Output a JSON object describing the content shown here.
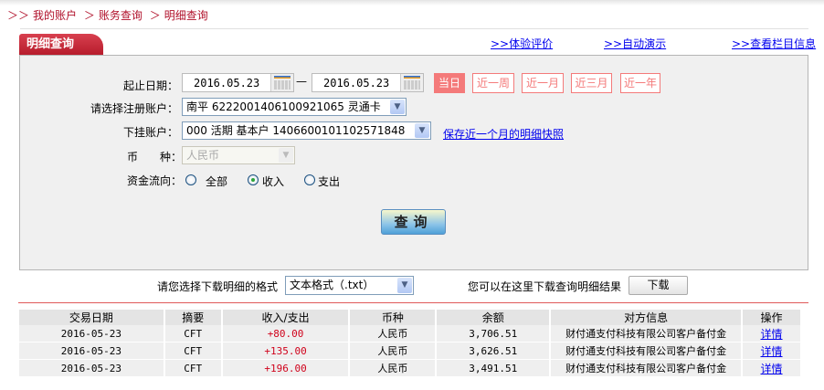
{
  "breadcrumb": {
    "items": [
      "我的账户",
      "账务查询",
      "明细查询"
    ]
  },
  "tab": {
    "title": "明细查询"
  },
  "top_links": [
    ">>体验评价",
    ">>自动演示",
    ">>查看栏目信息"
  ],
  "form": {
    "date_label": "起止日期：",
    "start_date": "2016.05.23",
    "dash": "—",
    "end_date": "2016.05.23",
    "quick_ranges": [
      {
        "label": "当日",
        "active": true
      },
      {
        "label": "近一周",
        "active": false
      },
      {
        "label": "近一月",
        "active": false
      },
      {
        "label": "近三月",
        "active": false
      },
      {
        "label": "近一年",
        "active": false
      }
    ],
    "reg_account_label": "请选择注册账户：",
    "reg_account_value": "南平  6222001406100921065 灵通卡",
    "sub_account_label": "下挂账户：",
    "sub_account_value": "000 活期 基本户 1406600101102571848",
    "snapshot_link": "保存近一个月的明细快照",
    "currency_label": "币　　种：",
    "currency_value": "人民币",
    "flow_label": "资金流向：",
    "flow_options": [
      {
        "label": "全部",
        "checked": false
      },
      {
        "label": "收入",
        "checked": true
      },
      {
        "label": "支出",
        "checked": false
      }
    ],
    "search_button": "查询"
  },
  "download": {
    "format_label": "请您选择下载明细的格式",
    "format_value": "文本格式（.txt）",
    "hint": "您可以在这里下载查询明细结果",
    "button": "下载"
  },
  "table": {
    "headers": [
      "交易日期",
      "摘要",
      "收入/支出",
      "币种",
      "余额",
      "对方信息",
      "操作"
    ],
    "rows": [
      [
        "2016-05-23",
        "CFT",
        "+80.00",
        "人民币",
        "3,706.51",
        "财付通支付科技有限公司客户备付金",
        "详情"
      ],
      [
        "2016-05-23",
        "CFT",
        "+135.00",
        "人民币",
        "3,626.51",
        "财付通支付科技有限公司客户备付金",
        "详情"
      ],
      [
        "2016-05-23",
        "CFT",
        "+196.00",
        "人民币",
        "3,491.51",
        "财付通支付科技有限公司客户备付金",
        "详情"
      ]
    ]
  },
  "colors": {
    "brand_red": "#b71c2c",
    "quick_range": "#f47a7a",
    "link": "#0000ee",
    "amount": "#d0021b"
  }
}
